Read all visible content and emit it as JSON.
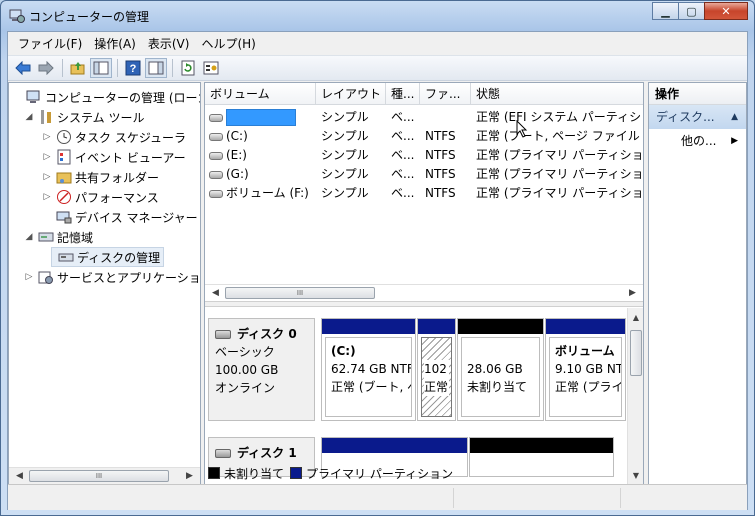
{
  "window": {
    "title": "コンピューターの管理"
  },
  "menu": [
    "ファイル(F)",
    "操作(A)",
    "表示(V)",
    "ヘルプ(H)"
  ],
  "tree": {
    "root": "コンピューターの管理 (ローカ",
    "system_tools": "システム ツール",
    "task_scheduler": "タスク スケジューラ",
    "event_viewer": "イベント ビューアー",
    "shared_folders": "共有フォルダー",
    "performance": "パフォーマンス",
    "device_manager": "デバイス マネージャー",
    "storage": "記憶域",
    "disk_management": "ディスクの管理",
    "services_apps": "サービスとアプリケーショ"
  },
  "volume_list": {
    "headers": [
      "ボリューム",
      "レイアウト",
      "種...",
      "ファ...",
      "状態"
    ],
    "rows": [
      {
        "volume": "",
        "layout": "シンプル",
        "type": "ベ...",
        "fs": "",
        "status": "正常 (EFI システム パーティシ"
      },
      {
        "volume": "(C:)",
        "layout": "シンプル",
        "type": "ベ...",
        "fs": "NTFS",
        "status": "正常 (ブート, ページ ファイル"
      },
      {
        "volume": "(E:)",
        "layout": "シンプル",
        "type": "ベ...",
        "fs": "NTFS",
        "status": "正常 (プライマリ パーティショ"
      },
      {
        "volume": "(G:)",
        "layout": "シンプル",
        "type": "ベ...",
        "fs": "NTFS",
        "status": "正常 (プライマリ パーティショ"
      },
      {
        "volume": "ボリューム (F:)",
        "layout": "シンプル",
        "type": "ベ...",
        "fs": "NTFS",
        "status": "正常 (プライマリ パーティショ"
      }
    ]
  },
  "disk0": {
    "name": "ディスク 0",
    "kind": "ベーシック",
    "size": "100.00 GB",
    "state": "オンライン",
    "partitions": [
      {
        "title": "(C:)",
        "line1": "62.74 GB NTF",
        "line2": "正常 (ブート, ペ"
      },
      {
        "title": "",
        "line1": "102",
        "line2": "正常"
      },
      {
        "title": "",
        "line1": "28.06 GB",
        "line2": "未割り当て"
      },
      {
        "title": "ボリューム",
        "line1": "9.10 GB NT",
        "line2": "正常 (プライ"
      }
    ]
  },
  "disk1": {
    "name": "ディスク 1"
  },
  "legend": {
    "unallocated": "未割り当て",
    "primary": "プライマリ パーティション"
  },
  "actions": {
    "header": "操作",
    "section": "ディスク...",
    "more": "他の..."
  },
  "colors": {
    "primary_partition": "#0a1a8c",
    "unallocated": "#000000",
    "selection": "#3399ff"
  }
}
